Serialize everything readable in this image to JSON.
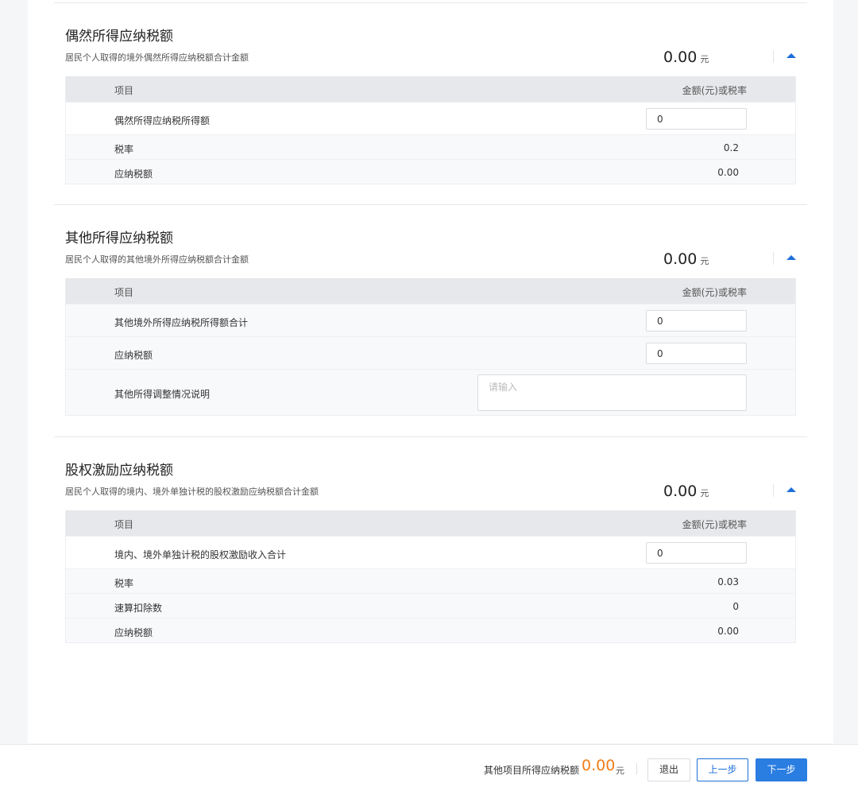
{
  "unit": "元",
  "table_headers": {
    "item": "项目",
    "amount": "金额(元)或税率"
  },
  "sections": [
    {
      "title": "偶然所得应纳税额",
      "desc": "居民个人取得的境外偶然所得应纳税额合计金额",
      "amount": "0.00",
      "rows": [
        {
          "label": "偶然所得应纳税所得额",
          "type": "input",
          "value": "0"
        },
        {
          "label": "税率",
          "type": "text",
          "value": "0.2"
        },
        {
          "label": "应纳税额",
          "type": "text",
          "value": "0.00"
        }
      ]
    },
    {
      "title": "其他所得应纳税额",
      "desc": "居民个人取得的其他境外所得应纳税额合计金额",
      "amount": "0.00",
      "rows": [
        {
          "label": "其他境外所得应纳税所得额合计",
          "type": "input",
          "value": "0"
        },
        {
          "label": "应纳税额",
          "type": "input",
          "value": "0"
        },
        {
          "label": "其他所得调整情况说明",
          "type": "textarea",
          "value": "",
          "placeholder": "请输入"
        }
      ]
    },
    {
      "title": "股权激励应纳税额",
      "desc": "居民个人取得的境内、境外单独计税的股权激励应纳税额合计金额",
      "amount": "0.00",
      "rows": [
        {
          "label": "境内、境外单独计税的股权激励收入合计",
          "type": "input",
          "value": "0"
        },
        {
          "label": "税率",
          "type": "text",
          "value": "0.03"
        },
        {
          "label": "速算扣除数",
          "type": "text",
          "value": "0"
        },
        {
          "label": "应纳税额",
          "type": "text",
          "value": "0.00"
        }
      ]
    }
  ],
  "footer": {
    "label": "其他项目所得应纳税额",
    "amount": "0.00",
    "unit": "元",
    "exit_label": "退出",
    "prev_label": "上一步",
    "next_label": "下一步"
  }
}
